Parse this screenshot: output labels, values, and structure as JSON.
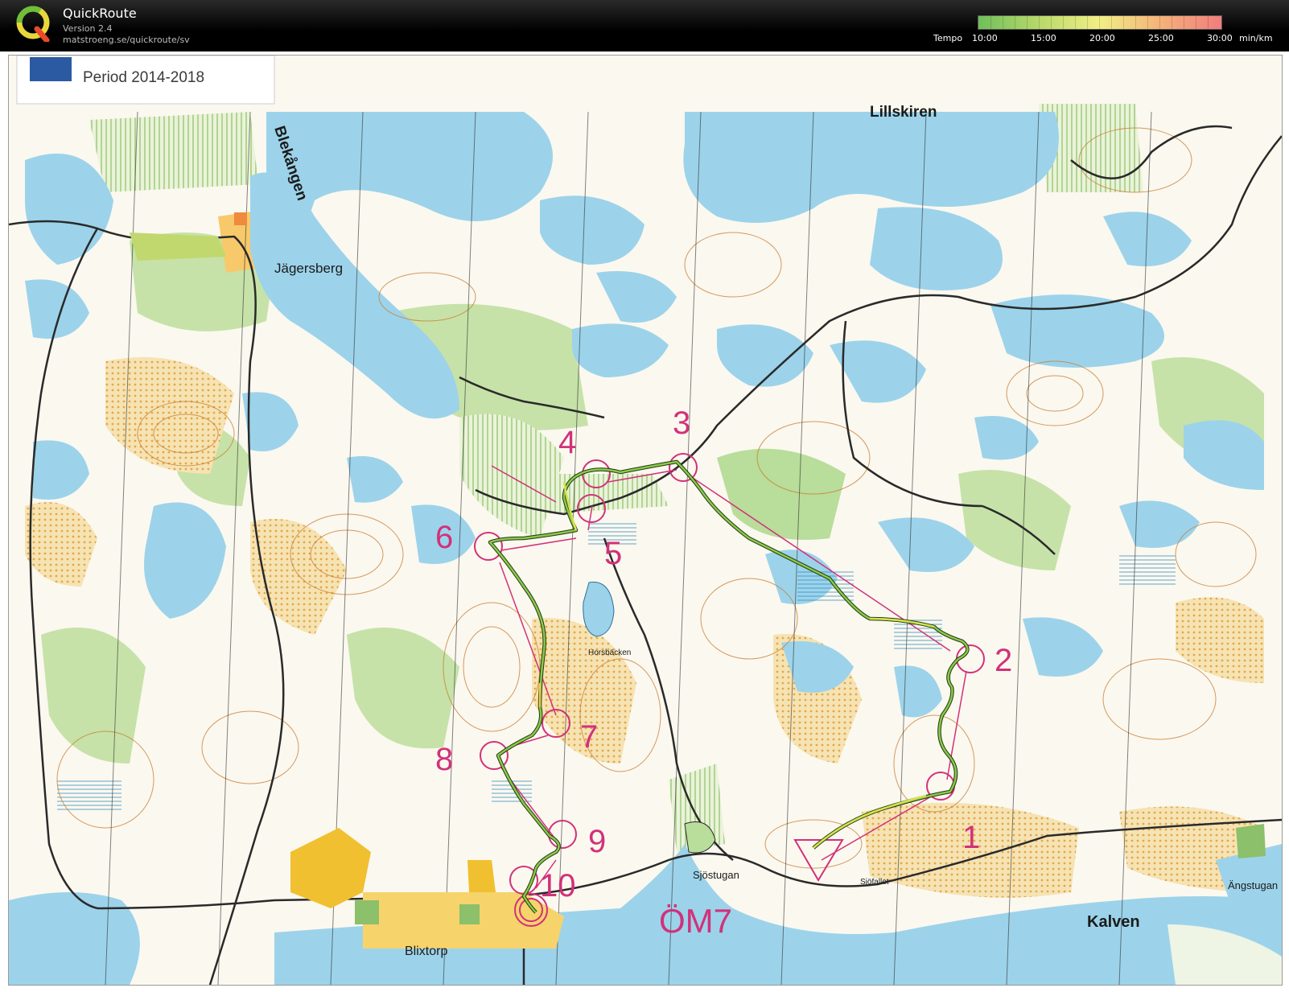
{
  "app": {
    "title": "QuickRoute",
    "version": "Version 2.4",
    "url": "matstroeng.se/quickroute/sv"
  },
  "tempo_scale": {
    "label": "Tempo",
    "ticks": [
      "10:00",
      "15:00",
      "20:00",
      "25:00",
      "30:00"
    ],
    "unit": "min/km",
    "colors": [
      "#6fbf5a",
      "#b8d96a",
      "#f2ef86",
      "#f4b27a",
      "#f27d7d"
    ]
  },
  "map": {
    "period_label": "Period 2014-2018",
    "place_names": [
      "Lillskiren",
      "Blekången",
      "Jägersberg",
      "Horsbäcken",
      "Sjöstugan",
      "Sjöfallet",
      "Ängstugan",
      "Kalven",
      "Blixtorp"
    ],
    "course_name": "ÖM7",
    "controls": [
      "1",
      "2",
      "3",
      "4",
      "5",
      "6",
      "7",
      "8",
      "9",
      "10"
    ],
    "colors": {
      "water": "#9cd3ea",
      "open_land": "#f7c96a",
      "rough_open": "#f4dca0",
      "forest_green": "#b9dd9a",
      "contour": "#c77a2d",
      "course": "#d2317a",
      "route": "#6b9e2f",
      "road": "#2a2a2a",
      "settlement": "#f0c030"
    }
  }
}
